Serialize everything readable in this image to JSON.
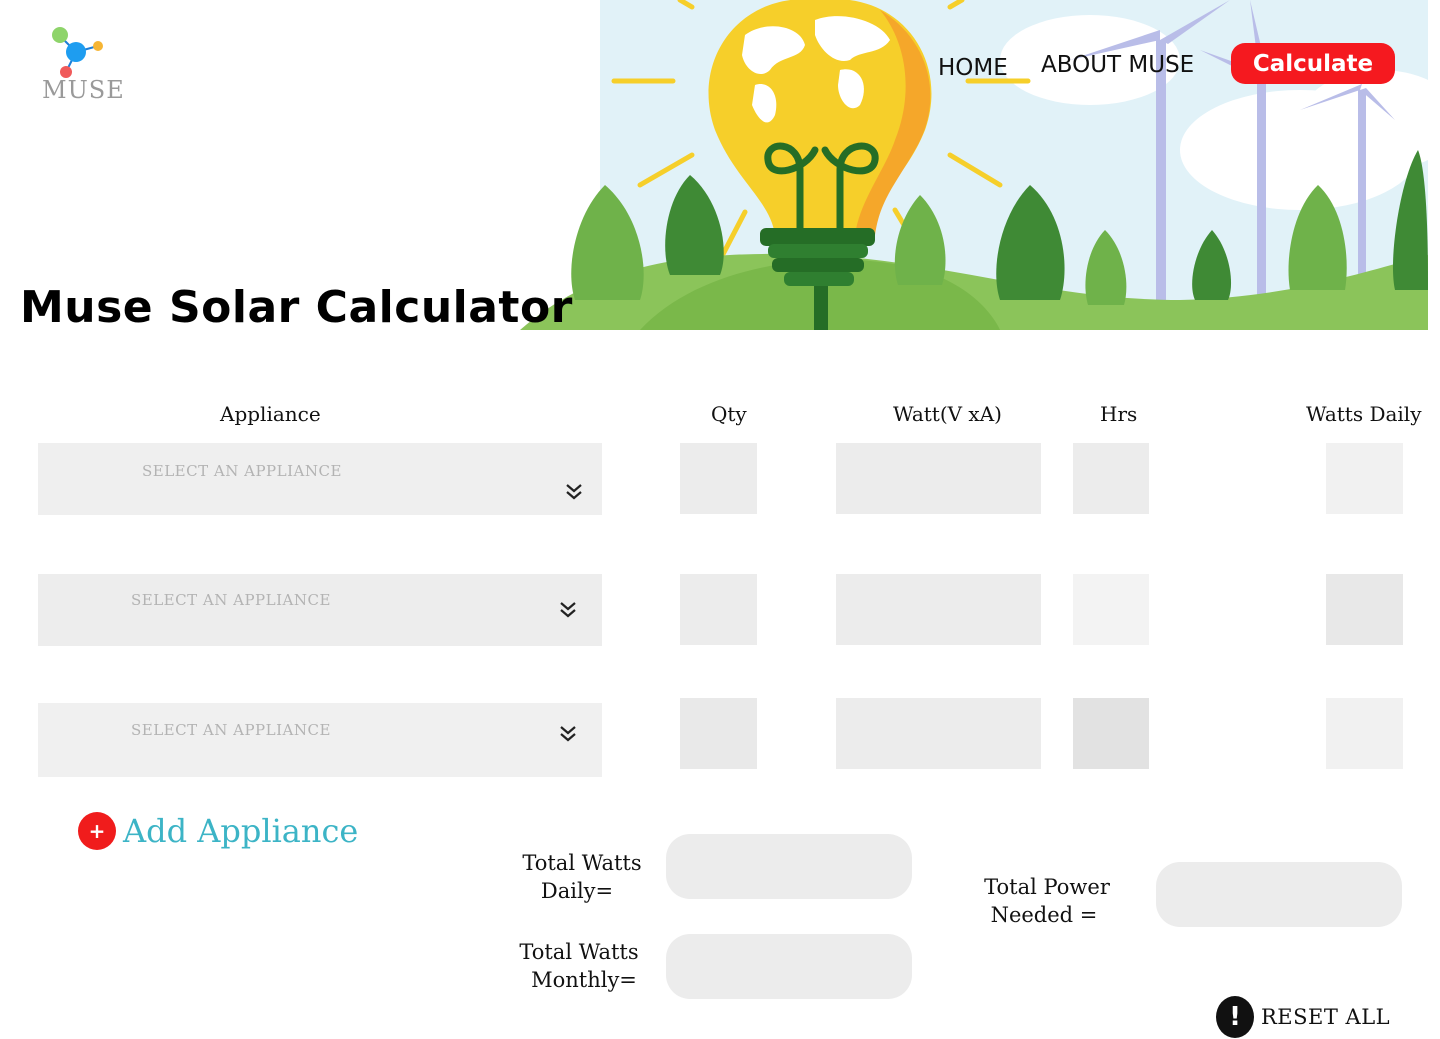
{
  "header": {
    "logo_text": "MUSE",
    "nav": {
      "home": "HOME",
      "about": "ABOUT MUSE"
    },
    "calculate_label": "Calculate",
    "title": "Muse Solar Calculator"
  },
  "table": {
    "headers": {
      "appliance": "Appliance",
      "qty": "Qty",
      "watt": "Watt(V xA)",
      "hrs": "Hrs",
      "watts_daily": "Watts Daily"
    },
    "rows": [
      {
        "appliance_placeholder": "SELECT AN APPLIANCE"
      },
      {
        "appliance_placeholder": "SELECT AN APPLIANCE"
      },
      {
        "appliance_placeholder": "SELECT AN APPLIANCE"
      }
    ]
  },
  "actions": {
    "add_icon": "+",
    "add_label": "Add Appliance",
    "reset_icon": "!",
    "reset_label": "RESET ALL"
  },
  "summary": {
    "total_daily_label_1": "Total Watts",
    "total_daily_label_2": "Daily=",
    "total_monthly_label_1": "Total Watts",
    "total_monthly_label_2": "Monthly=",
    "total_power_label_1": "Total Power",
    "total_power_label_2": "Needed ="
  },
  "colors": {
    "accent_red": "#f5191f",
    "add_text": "#3cb4c6",
    "field_bg": "#ececec"
  },
  "icons": [
    "logo-molecule-icon",
    "chevron-double-down-icon",
    "plus-icon",
    "exclamation-icon"
  ]
}
